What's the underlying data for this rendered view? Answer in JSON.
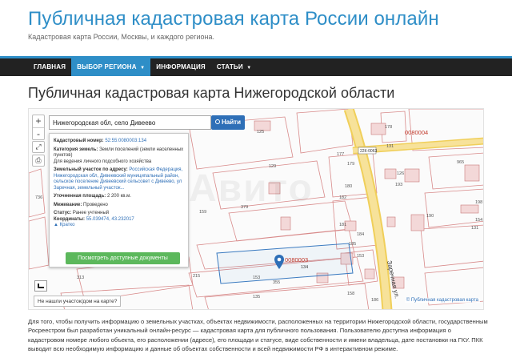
{
  "site": {
    "title": "Публичная кадастровая карта России онлайн",
    "tagline": "Кадастровая карта России, Москвы, и каждого региона.",
    "accent_color": "#2e8ec7"
  },
  "nav": {
    "items": [
      {
        "label": "ГЛАВНАЯ"
      },
      {
        "label": "ВЫБОР РЕГИОНА",
        "caret": "▼"
      },
      {
        "label": "ИНФОРМАЦИЯ"
      },
      {
        "label": "СТАТЬИ",
        "caret": "▼"
      }
    ]
  },
  "page": {
    "heading": "Публичная кадастровая карта Нижегородской области"
  },
  "map": {
    "search_value": "Нижегородская обл, село Дивеево",
    "search_button": "Найти",
    "zoom_in": "+",
    "zoom_out": "-",
    "fullscreen_icon": "⤢",
    "print_icon": "⎙",
    "info": {
      "cad_label": "Кадастровый номер:",
      "cad_value": "52:55:0080003:134",
      "category_label": "Категория земель:",
      "category_value": "Земли поселений (земли населенных пунктов)",
      "use_value": "Для ведения личного подсобного хозяйства",
      "address_label": "Земельный участок по адресу:",
      "address_value": "Российская Федерация, Нижегородская обл, Дивеевский муниципальный район, сельское поселение Дивеевский сельсовет с Дивеево, ул Заречная, земельный участок...",
      "area_label": "Уточненная площадь:",
      "area_value": "2 200 кв.м.",
      "survey_label": "Межевание:",
      "survey_value": "Проведено",
      "status_label": "Статус:",
      "status_value": "Ранее учтенный",
      "coords_label": "Координаты:",
      "coords_value": "55.039474, 43.232017",
      "toggle": "▲ Кратко",
      "cta": "Посмотреть доступные документы"
    },
    "not_found": "Не нашли участок/дом на карте?",
    "copyright": "© Публичная кадастровая карта",
    "watermark": "Авито",
    "labels": {
      "street": "Заречная ул.",
      "road_sign": "22К-0063",
      "plot_red_1": "0080004",
      "plot_red_2": "0080003",
      "plot_134": "134",
      "plot_nums": [
        "162",
        "125",
        "178",
        "131",
        "129",
        "177",
        "179",
        "965",
        "126",
        "193",
        "180",
        "182",
        "736",
        "379",
        "159",
        "198",
        "154",
        "181",
        "184",
        "185",
        "153",
        "190",
        "131",
        "171",
        "313",
        "215",
        "153",
        "355",
        "135",
        "158",
        "186"
      ]
    }
  },
  "description": "Для того, чтобы получить информацию о земельных участках, объектах недвижимости, расположенных на территории Нижегородской области, государственным Росреестром был разработан уникальный онлайн-ресурс — кадастровая карта для публичного пользования. Пользователю доступна информация о кадастровом номере любого объекта, его расположении (адресе), его площади и статусе, виде собственности и имени владельца, дате постановки на ГКУ. ПКК выводит всю необходимую информацию и данные об объектах собственности и всей недвижимости РФ в интерактивном режиме."
}
